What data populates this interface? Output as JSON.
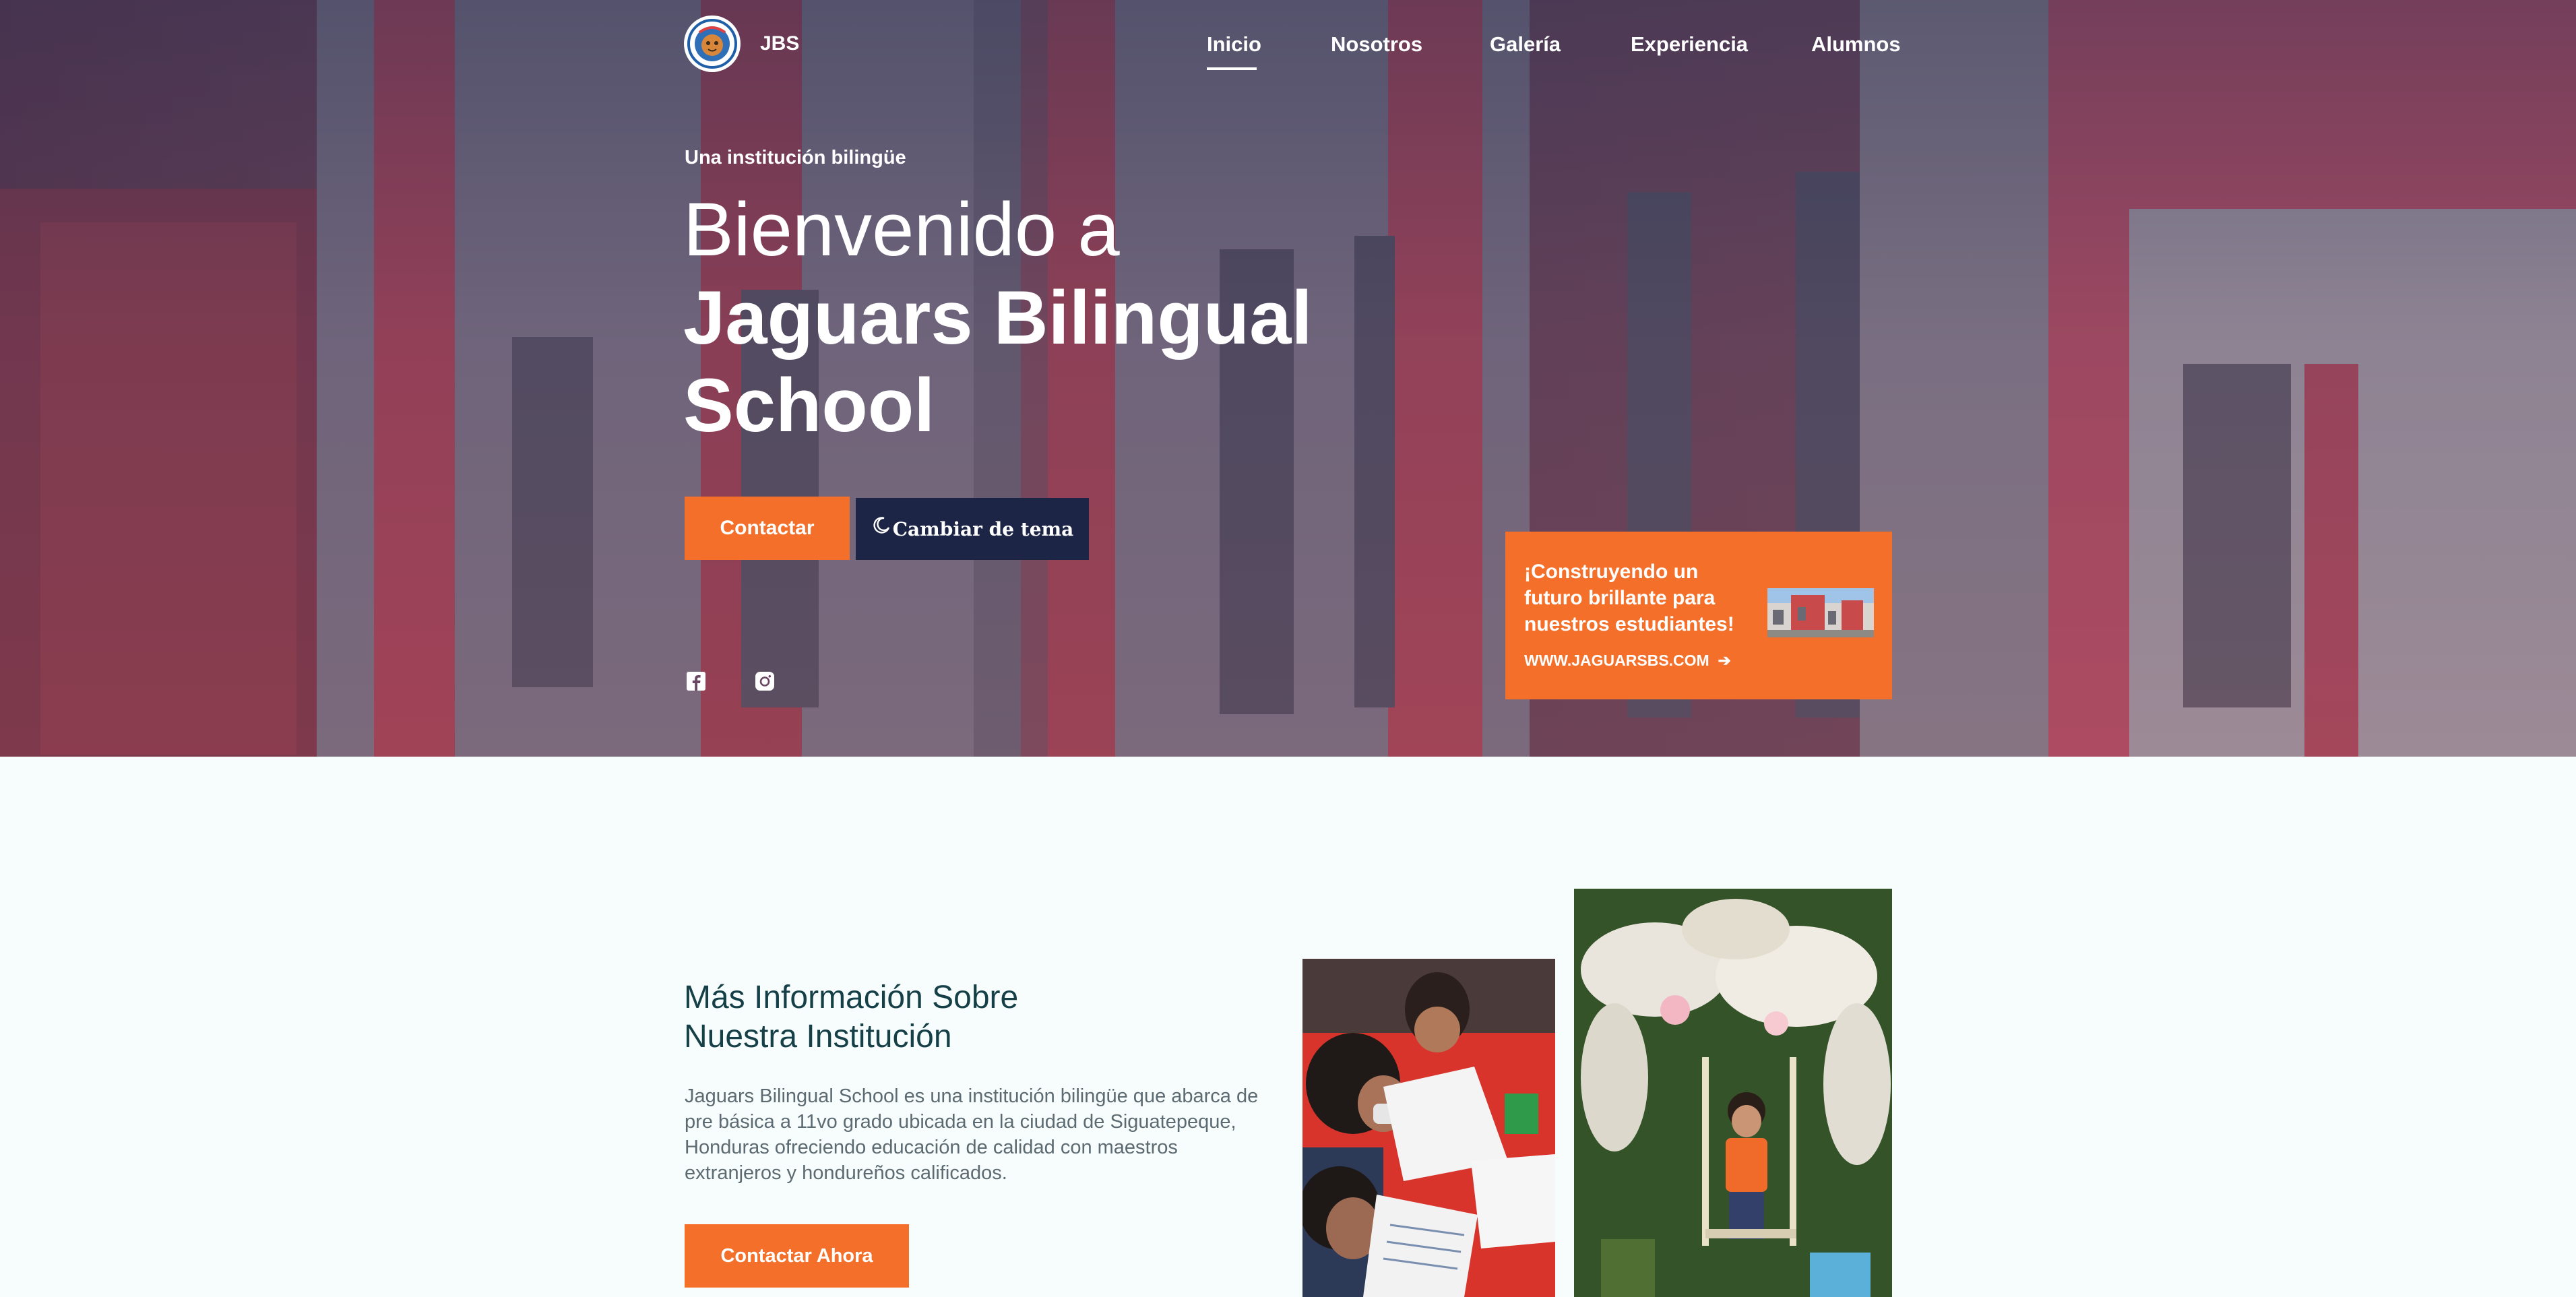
{
  "brand": {
    "short_name": "JBS"
  },
  "nav": {
    "items": [
      {
        "label": "Inicio",
        "active": true
      },
      {
        "label": "Nosotros",
        "active": false
      },
      {
        "label": "Galería",
        "active": false
      },
      {
        "label": "Experiencia",
        "active": false
      },
      {
        "label": "Alumnos",
        "active": false
      }
    ]
  },
  "hero": {
    "kicker": "Una institución bilingüe",
    "title_line1": "Bienvenido a",
    "title_line2": "Jaguars Bilingual",
    "title_line3": "School",
    "contact_button": "Contactar",
    "theme_button": "Cambiar de tema",
    "social_icons": [
      "facebook-icon",
      "instagram-icon"
    ]
  },
  "promo": {
    "text": "¡Construyendo un futuro brillante para nuestros estudiantes!",
    "link": "WWW.JAGUARSBS.COM"
  },
  "info": {
    "title_line1": "Más Información Sobre",
    "title_line2": "Nuestra Institución",
    "description": "Jaguars Bilingual School es una institución bilingüe que abarca de pre básica a 11vo grado ubicada en la ciudad de Siguatepeque, Honduras ofreciendo educación de calidad con maestros extranjeros y hondureños calificados.",
    "button": "Contactar Ahora"
  },
  "colors": {
    "accent": "#f4702a",
    "dark_button": "#1c2545",
    "heading": "#164048",
    "body_text": "#5c6a72",
    "section_bg": "#f7fcfc"
  }
}
